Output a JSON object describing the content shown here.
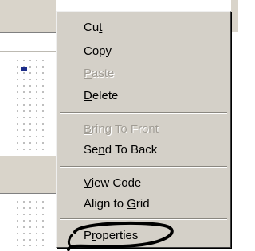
{
  "context_menu": {
    "items": [
      {
        "before": "Cu",
        "key": "t",
        "after": "",
        "enabled": true
      },
      {
        "before": "",
        "key": "C",
        "after": "opy",
        "enabled": true
      },
      {
        "before": "",
        "key": "P",
        "after": "aste",
        "enabled": false
      },
      {
        "before": "",
        "key": "D",
        "after": "elete",
        "enabled": true
      },
      {
        "before": "",
        "key": "B",
        "after": "ring To Front",
        "enabled": false
      },
      {
        "before": "Se",
        "key": "n",
        "after": "d To Back",
        "enabled": true
      },
      {
        "before": "",
        "key": "V",
        "after": "iew Code",
        "enabled": true
      },
      {
        "before": "Align to ",
        "key": "G",
        "after": "rid",
        "enabled": true
      },
      {
        "before": "P",
        "key": "r",
        "after": "operties",
        "enabled": true
      }
    ]
  },
  "colors": {
    "menu_background": "#d4d0c8",
    "disabled_text": "#a09c94",
    "selection_handle": "#1d2d8a",
    "annotation_ink": "#000000"
  }
}
